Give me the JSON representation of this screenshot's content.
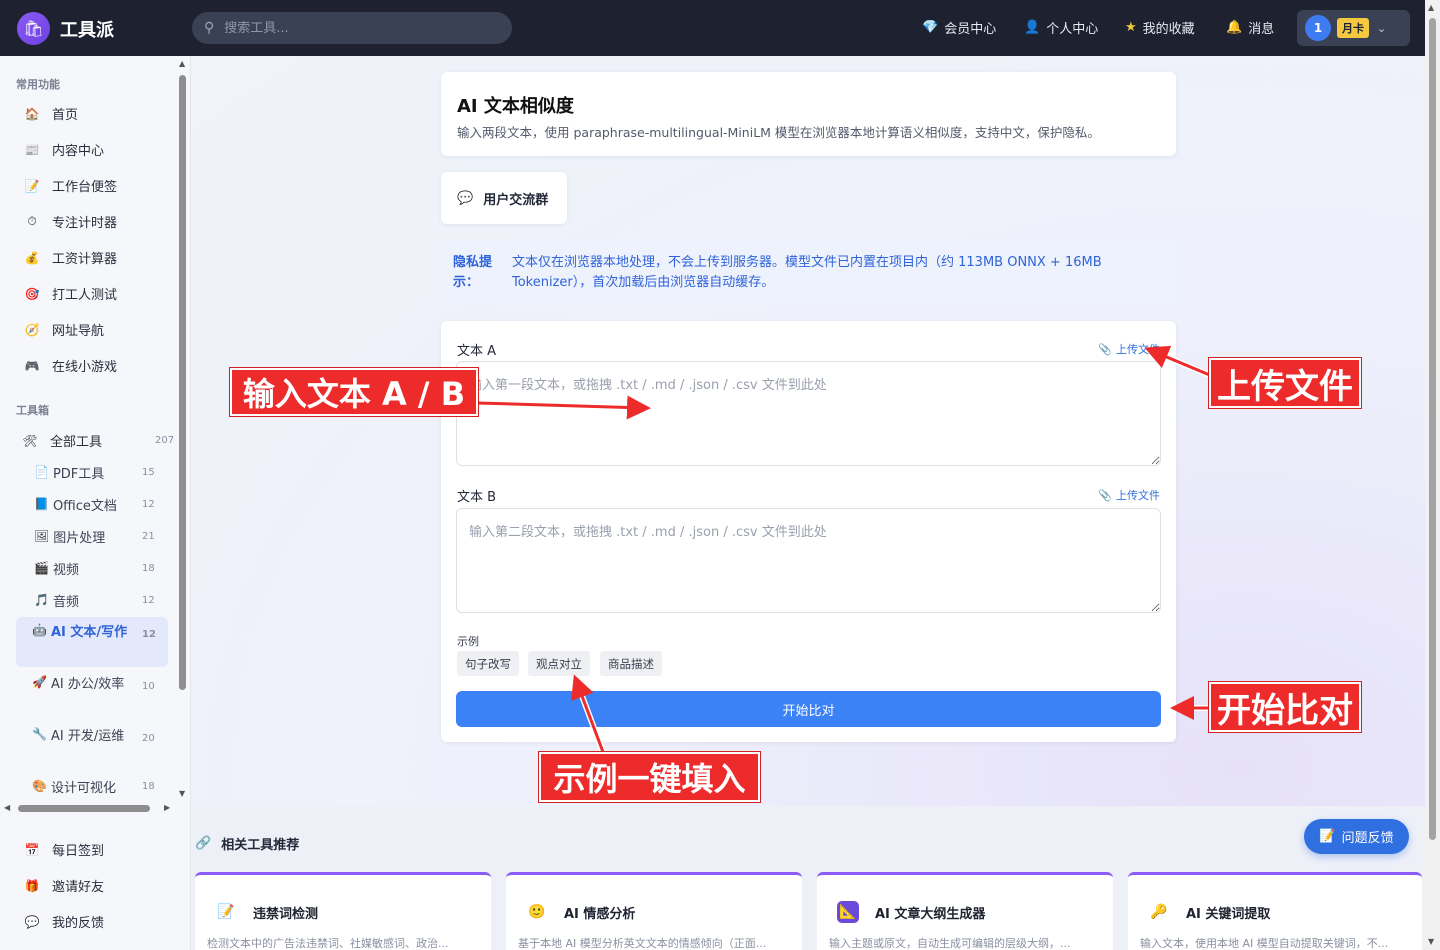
{
  "app": {
    "name": "工具派"
  },
  "search": {
    "placeholder": "搜索工具..."
  },
  "topnav": [
    {
      "label": "会员中心",
      "icon": "diamond-icon"
    },
    {
      "label": "个人中心",
      "icon": "person-icon"
    },
    {
      "label": "我的收藏",
      "icon": "star-icon"
    },
    {
      "label": "消息",
      "icon": "bell-icon"
    }
  ],
  "user": {
    "avatar_text": "1",
    "plan_badge": "月卡"
  },
  "sidebar": {
    "common_title": "常用功能",
    "common": [
      {
        "label": "首页",
        "icon": "🏠"
      },
      {
        "label": "内容中心",
        "icon": "📰"
      },
      {
        "label": "工作台便签",
        "icon": "📝"
      },
      {
        "label": "专注计时器",
        "icon": "⏱"
      },
      {
        "label": "工资计算器",
        "icon": "💰"
      },
      {
        "label": "打工人测试",
        "icon": "🎯"
      },
      {
        "label": "网址导航",
        "icon": "🧭"
      },
      {
        "label": "在线小游戏",
        "icon": "🎮"
      }
    ],
    "toolbox_title": "工具箱",
    "all_tools": {
      "label": "全部工具",
      "count": "207"
    },
    "categories": [
      {
        "label": "PDF工具",
        "count": "15",
        "icon": "📄"
      },
      {
        "label": "Office文档",
        "count": "12",
        "icon": "📘"
      },
      {
        "label": "图片处理",
        "count": "21",
        "icon": "🖼"
      },
      {
        "label": "视频",
        "count": "18",
        "icon": "🎬"
      },
      {
        "label": "音频",
        "count": "12",
        "icon": "🎵"
      },
      {
        "label": "AI 文本/写作",
        "count": "12",
        "icon": "🤖"
      },
      {
        "label": "AI 办公/效率",
        "count": "10",
        "icon": "🚀"
      },
      {
        "label": "AI 开发/运维",
        "count": "20",
        "icon": "🔧"
      },
      {
        "label": "设计可视化",
        "count": "18",
        "icon": "🎨"
      }
    ],
    "bottom": [
      {
        "label": "每日签到",
        "icon": "📅"
      },
      {
        "label": "邀请好友",
        "icon": "🎁"
      },
      {
        "label": "我的反馈",
        "icon": "💬"
      }
    ]
  },
  "page": {
    "title": "AI 文本相似度",
    "subtitle": "输入两段文本，使用 paraphrase-multilingual-MiniLM 模型在浏览器本地计算语义相似度，支持中文，保护隐私。",
    "group_button": "用户交流群",
    "privacy_label": "隐私提示：",
    "privacy_text": "文本仅在浏览器本地处理，不会上传到服务器。模型文件已内置在项目内（约 113MB ONNX + 16MB Tokenizer），首次加载后由浏览器自动缓存。",
    "text_a_label": "文本 A",
    "text_a_placeholder": "输入第一段文本，或拖拽 .txt / .md / .json / .csv 文件到此处",
    "text_b_label": "文本 B",
    "text_b_placeholder": "输入第二段文本，或拖拽 .txt / .md / .json / .csv 文件到此处",
    "upload_label": "上传文件",
    "examples_label": "示例",
    "examples": [
      "句子改写",
      "观点对立",
      "商品描述"
    ],
    "start_button": "开始比对"
  },
  "related": {
    "title": "相关工具推荐",
    "tools": [
      {
        "name": "违禁词检测",
        "desc": "检测文本中的广告法违禁词、社媒敏感词、政治...",
        "icon": "📝"
      },
      {
        "name": "AI 情感分析",
        "desc": "基于本地 AI 模型分析英文文本的情感倾向（正面...",
        "icon": "🙂"
      },
      {
        "name": "AI 文章大纲生成器",
        "desc": "输入主题或原文，自动生成可编辑的层级大纲，...",
        "icon": "📐"
      },
      {
        "name": "AI 关键词提取",
        "desc": "输入文本，使用本地 AI 模型自动提取关键词，不...",
        "icon": "🔑"
      }
    ]
  },
  "feedback_button": "问题反馈",
  "annotations": {
    "input": "输入文本 A / B",
    "upload": "上传文件",
    "start": "开始比对",
    "example": "示例一键填入"
  }
}
